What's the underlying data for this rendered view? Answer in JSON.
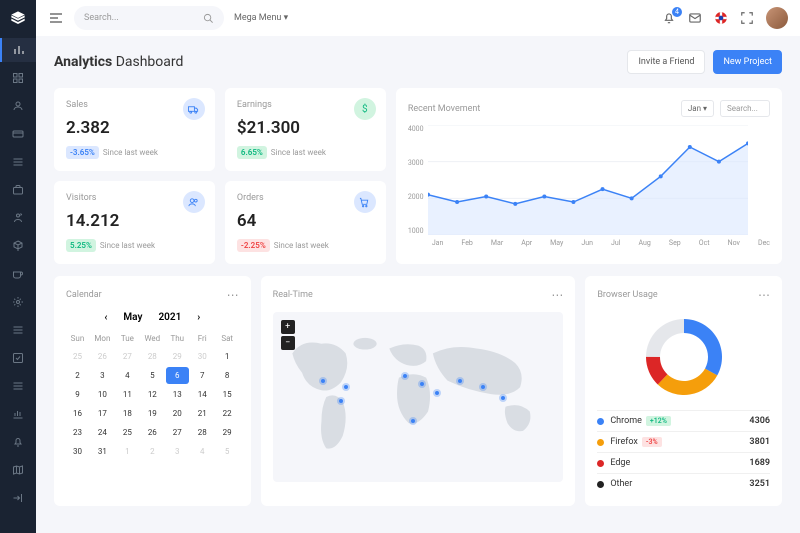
{
  "header": {
    "search_placeholder": "Search...",
    "mega_menu": "Mega Menu",
    "notif_count": "4"
  },
  "page": {
    "title_bold": "Analytics",
    "title_rest": " Dashboard",
    "invite": "Invite a Friend",
    "new_project": "New Project"
  },
  "stats": {
    "sales": {
      "label": "Sales",
      "value": "2.382",
      "delta": "-3.65%",
      "since": "Since last week"
    },
    "earnings": {
      "label": "Earnings",
      "value": "$21.300",
      "delta": "6.65%",
      "since": "Since last week"
    },
    "visitors": {
      "label": "Visitors",
      "value": "14.212",
      "delta": "5.25%",
      "since": "Since last week"
    },
    "orders": {
      "label": "Orders",
      "value": "64",
      "delta": "-2.25%",
      "since": "Since last week"
    }
  },
  "movement": {
    "title": "Recent Movement",
    "range": "Jan",
    "search": "Search..."
  },
  "calendar": {
    "title": "Calendar",
    "month": "May",
    "year": "2021",
    "dows": [
      "Sun",
      "Mon",
      "Tue",
      "Wed",
      "Thu",
      "Fri",
      "Sat"
    ],
    "prev_days": [
      "25",
      "26",
      "27",
      "28",
      "29",
      "30"
    ],
    "days": [
      "1",
      "2",
      "3",
      "4",
      "5",
      "6",
      "7",
      "8",
      "9",
      "10",
      "11",
      "12",
      "13",
      "14",
      "15",
      "16",
      "17",
      "18",
      "19",
      "20",
      "21",
      "22",
      "23",
      "24",
      "25",
      "26",
      "27",
      "28",
      "29",
      "30",
      "31"
    ],
    "next_days": [
      "1",
      "2",
      "3",
      "4",
      "5"
    ],
    "selected": "6"
  },
  "realtime": {
    "title": "Real-Time"
  },
  "browser": {
    "title": "Browser Usage",
    "rows": [
      {
        "name": "Chrome",
        "delta": "+12%",
        "delta_cls": "delta-pos",
        "color": "#3b82f6",
        "value": "4306"
      },
      {
        "name": "Firefox",
        "delta": "-3%",
        "delta_cls": "delta-red",
        "color": "#f59e0b",
        "value": "3801"
      },
      {
        "name": "Edge",
        "delta": "",
        "delta_cls": "",
        "color": "#dc2626",
        "value": "1689"
      },
      {
        "name": "Other",
        "delta": "",
        "delta_cls": "",
        "color": "#222",
        "value": "3251"
      }
    ]
  },
  "chart_data": {
    "type": "line",
    "title": "Recent Movement",
    "categories": [
      "Jan",
      "Feb",
      "Mar",
      "Apr",
      "May",
      "Jun",
      "Jul",
      "Aug",
      "Sep",
      "Oct",
      "Nov",
      "Dec"
    ],
    "values": [
      2100,
      1900,
      2050,
      1850,
      2050,
      1900,
      2250,
      2000,
      2600,
      3400,
      3000,
      3500
    ],
    "ylabel": "",
    "ylim": [
      1000,
      4000
    ],
    "yticks": [
      1000,
      2000,
      3000,
      4000
    ]
  },
  "donut_data": {
    "type": "pie",
    "series": [
      {
        "name": "Chrome",
        "value": 4306,
        "color": "#3b82f6"
      },
      {
        "name": "Firefox",
        "value": 3801,
        "color": "#f59e0b"
      },
      {
        "name": "Edge",
        "value": 1689,
        "color": "#dc2626"
      },
      {
        "name": "Other",
        "value": 3251,
        "color": "#e5e7eb"
      }
    ]
  }
}
